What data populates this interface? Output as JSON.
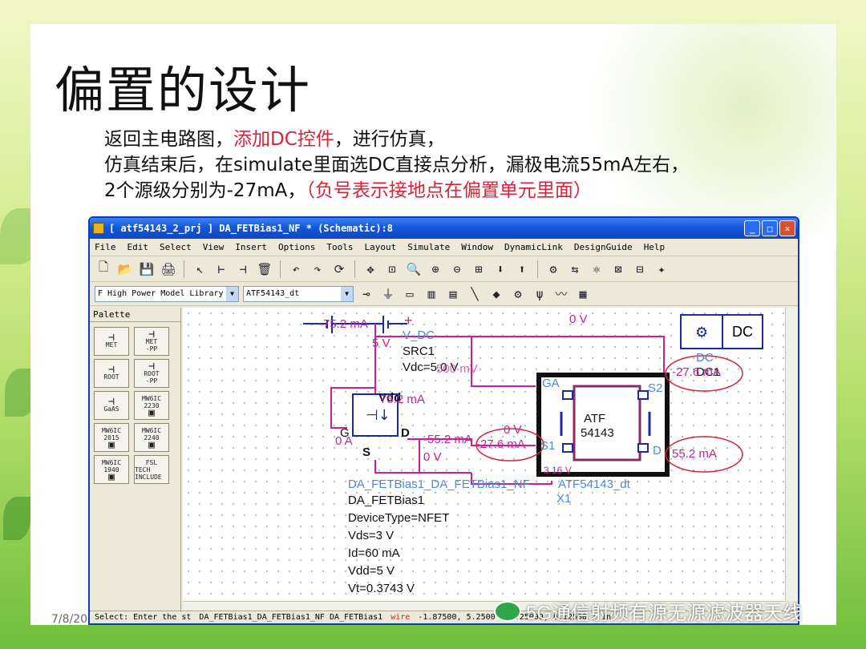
{
  "slide": {
    "title": "偏置的设计",
    "line1_a": "返回主电路图，",
    "line1_red": "添加DC控件",
    "line1_b": "，进行仿真，",
    "line2": "仿真结束后，在simulate里面选DC直接点分析，漏极电流55mA左右，",
    "line3_a": "2个源级分别为-27mA，",
    "line3_red": "（负号表示接地点在偏置单元里面）",
    "date": "7/8/20",
    "watermark": "5G通信射频有源无源滤波器天线"
  },
  "window": {
    "title": "[ atf54143_2_prj ] DA_FETBias1_NF * (Schematic):8",
    "menu": [
      "File",
      "Edit",
      "Select",
      "View",
      "Insert",
      "Options",
      "Tools",
      "Layout",
      "Simulate",
      "Window",
      "DynamicLink",
      "DesignGuide",
      "Help"
    ],
    "library_combo": "F High Power Model Library",
    "component_combo": "ATF54143_dt",
    "palette_title": "Palette",
    "palette_items": [
      {
        "label": "MET",
        "sub": ""
      },
      {
        "label": "MET",
        "sub": "-PP"
      },
      {
        "label": "ROOT",
        "sub": ""
      },
      {
        "label": "ROOT",
        "sub": "-PP"
      },
      {
        "label": "GaAS",
        "sub": ""
      },
      {
        "label": "MW6IC",
        "sub": "2230"
      },
      {
        "label": "MW6IC",
        "sub": "2015"
      },
      {
        "label": "MW6IC",
        "sub": "2240"
      },
      {
        "label": "MW6IC",
        "sub": "1940"
      },
      {
        "label": "FSL",
        "sub": "TECH INCLUDE"
      }
    ],
    "status": {
      "select": "Select: Enter the st",
      "design": "DA_FETBias1_DA_FETBias1_NF DA_FETBias1",
      "mode": "wire",
      "coord": "-1.87500, 5.2500 / 0.25000, 0.12500 / in"
    }
  },
  "schematic": {
    "src_current": "-75.2 mA",
    "src_voltage": "5 V",
    "vdc_name": "V_DC",
    "src_label": "SRC1",
    "vdc_value": "Vdc=5.0 V",
    "vdc_overlap": "500 mV",
    "top_voltage": "0 V",
    "dc_label": "DC",
    "dc_name": "DC",
    "dc_inst": "DC1",
    "s2_current": "-27.6 mA",
    "vdd_pin": "Vdd",
    "vdd_current": "75.2 mA",
    "g_pin": "G",
    "g_current": "0 A",
    "d_pin": "D",
    "s_pin": "S",
    "d_current": "-55.2 mA",
    "s_voltage": "0 V",
    "g_voltage": "0 V",
    "s1_current": "-27.6 mA",
    "s1_pin": "S1",
    "s2_pin": "S2",
    "ga_pin": "GA",
    "d_out_pin": "D",
    "drain_current": "55.2 mA",
    "dv": "3.16 V",
    "atf_line1": "ATF",
    "atf_line2": "54143",
    "atf_label": "ATF54143_dt",
    "atf_inst": "X1",
    "bias_overlap": "DA_FETBias1_DA_FETBias1_NF",
    "bias_name": "DA_FETBias1",
    "params": [
      "DeviceType=NFET",
      "Vds=3 V",
      "Id=60 mA",
      "Vdd=5 V",
      "Vt=0.3743 V"
    ]
  },
  "colors": {
    "wire": "#c8209d",
    "net": "#4c8ad6",
    "annotation": "#d6243a"
  }
}
